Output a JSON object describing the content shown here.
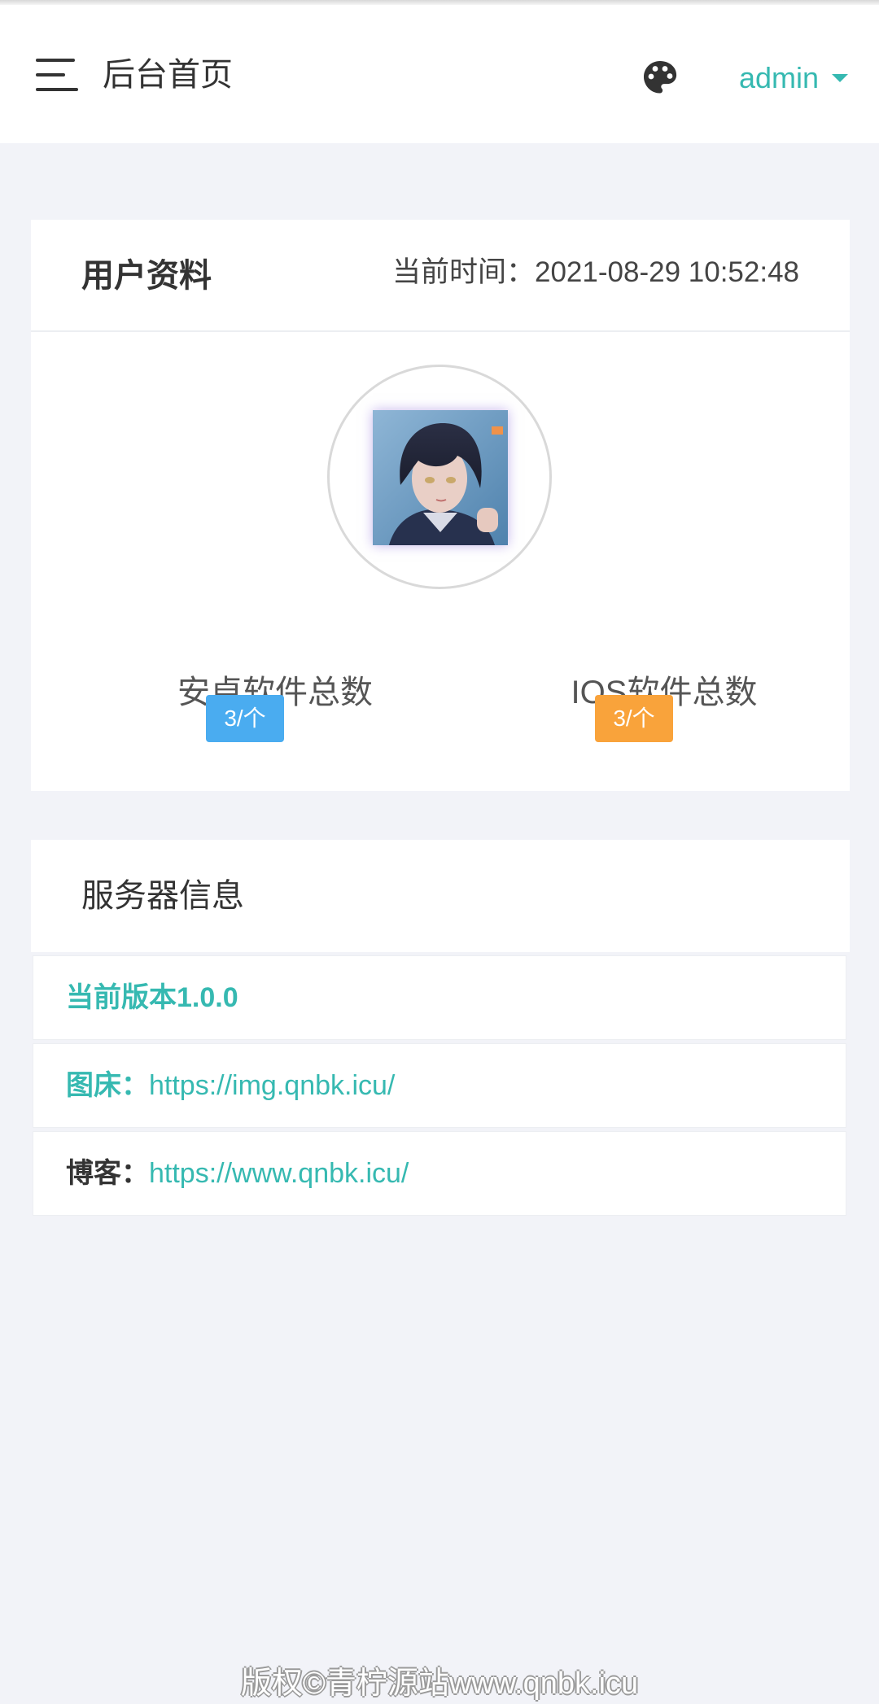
{
  "header": {
    "title": "后台首页",
    "user_name": "admin",
    "icons": {
      "menu": "menu-icon",
      "theme": "palette-icon",
      "dropdown": "caret-down-icon"
    }
  },
  "profile_card": {
    "title": "用户资料",
    "time_label": "当前时间：",
    "time_value": "2021-08-29 10:52:48",
    "stats": [
      {
        "label": "安卓软件总数",
        "badge": "3/个",
        "badge_color": "#4aacf0"
      },
      {
        "label": "IOS软件总数",
        "badge": "3/个",
        "badge_color": "#f9a33b"
      }
    ]
  },
  "server_card": {
    "title": "服务器信息",
    "version": "当前版本1.0.0",
    "rows": [
      {
        "label": "图床：",
        "link": "https://img.qnbk.icu/"
      },
      {
        "label": "博客：",
        "link": "https://www.qnbk.icu/"
      }
    ]
  },
  "footer": {
    "copyright": "版权©青柠源站www.qnbk.icu"
  },
  "colors": {
    "accent": "#36b9b1",
    "background": "#f2f3f8"
  }
}
